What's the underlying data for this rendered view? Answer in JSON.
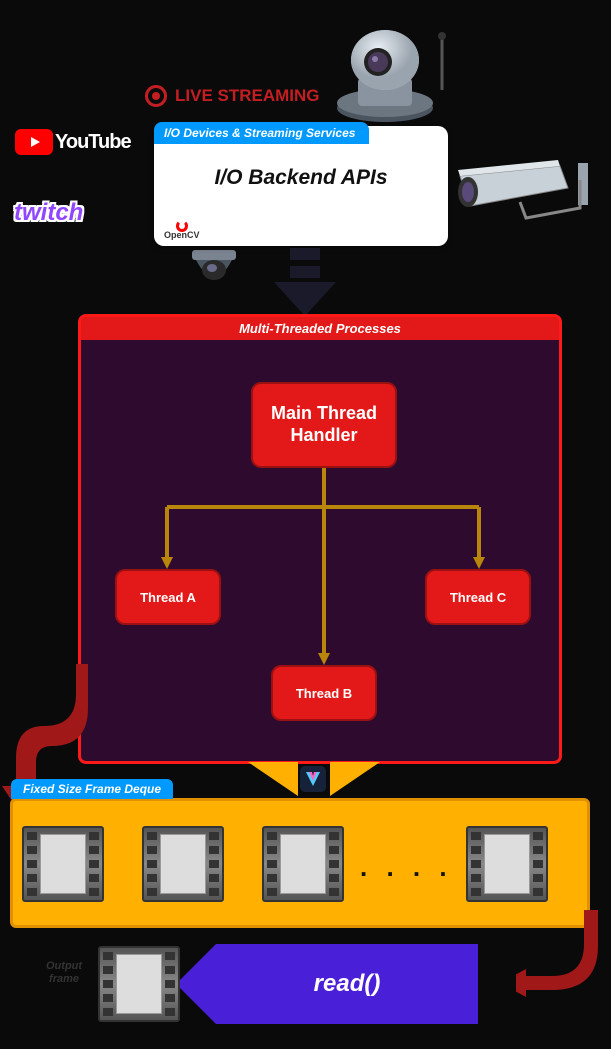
{
  "top": {
    "live_streaming": "LIVE STREAMING",
    "youtube": "YouTube",
    "twitch": "twitch"
  },
  "io_box": {
    "tab": "I/O Devices & Streaming Services",
    "title": "I/O Backend APIs",
    "opencv": "OpenCV"
  },
  "mt": {
    "header": "Multi-Threaded Processes",
    "main": "Main Thread Handler",
    "thread_a": "Thread A",
    "thread_b": "Thread B",
    "thread_c": "Thread C"
  },
  "deque": {
    "tab": "Fixed Size Frame Deque",
    "ellipsis": ". . . ."
  },
  "output": {
    "label": "Output\nframe",
    "read": "read()"
  }
}
